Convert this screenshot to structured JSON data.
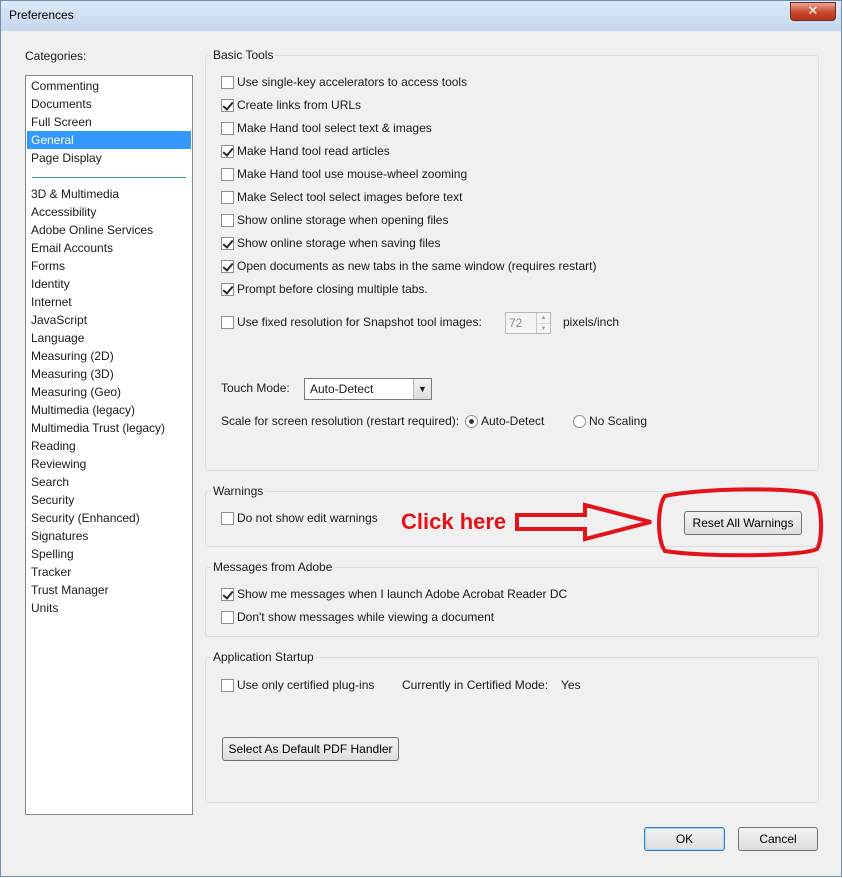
{
  "window": {
    "title": "Preferences",
    "close_glyph": "✕"
  },
  "categories": {
    "label": "Categories:",
    "items": [
      "Commenting",
      "Documents",
      "Full Screen",
      "General",
      "Page Display",
      "3D & Multimedia",
      "Accessibility",
      "Adobe Online Services",
      "Email Accounts",
      "Forms",
      "Identity",
      "Internet",
      "JavaScript",
      "Language",
      "Measuring (2D)",
      "Measuring (3D)",
      "Measuring (Geo)",
      "Multimedia (legacy)",
      "Multimedia Trust (legacy)",
      "Reading",
      "Reviewing",
      "Search",
      "Security",
      "Security (Enhanced)",
      "Signatures",
      "Spelling",
      "Tracker",
      "Trust Manager",
      "Units"
    ],
    "selected": "General"
  },
  "basic_tools": {
    "title": "Basic Tools",
    "options": [
      {
        "label": "Use single-key accelerators to access tools",
        "checked": false
      },
      {
        "label": "Create links from URLs",
        "checked": true
      },
      {
        "label": "Make Hand tool select text & images",
        "checked": false
      },
      {
        "label": "Make Hand tool read articles",
        "checked": true
      },
      {
        "label": "Make Hand tool use mouse-wheel zooming",
        "checked": false
      },
      {
        "label": "Make Select tool select images before text",
        "checked": false
      },
      {
        "label": "Show online storage when opening files",
        "checked": false
      },
      {
        "label": "Show online storage when saving files",
        "checked": true
      },
      {
        "label": "Open documents as new tabs in the same window (requires restart)",
        "checked": true
      },
      {
        "label": "Prompt before closing multiple tabs.",
        "checked": true
      }
    ],
    "snapshot": {
      "label": "Use fixed resolution for Snapshot tool images:",
      "checked": false,
      "value": "72",
      "unit": "pixels/inch"
    },
    "touch_mode": {
      "label": "Touch Mode:",
      "value": "Auto-Detect"
    },
    "scale": {
      "label": "Scale for screen resolution (restart required):",
      "option_auto": "Auto-Detect",
      "option_none": "No Scaling",
      "selected": "Auto-Detect"
    }
  },
  "warnings": {
    "title": "Warnings",
    "option": {
      "label": "Do not show edit warnings",
      "checked": false
    },
    "reset_button": "Reset All Warnings"
  },
  "annotation": {
    "text": "Click here",
    "color": "#e0141a"
  },
  "messages": {
    "title": "Messages from Adobe",
    "options": [
      {
        "label": "Show me messages when I launch Adobe Acrobat Reader DC",
        "checked": true
      },
      {
        "label": "Don't show messages while viewing a document",
        "checked": false
      }
    ]
  },
  "startup": {
    "title": "Application Startup",
    "certified": {
      "label": "Use only certified plug-ins",
      "checked": false
    },
    "mode_label": "Currently in Certified Mode:",
    "mode_value": "Yes",
    "default_handler_button": "Select As Default PDF Handler"
  },
  "footer": {
    "ok": "OK",
    "cancel": "Cancel"
  },
  "colors": {
    "selection": "#3399ff",
    "annotation_red": "#e0141a"
  }
}
